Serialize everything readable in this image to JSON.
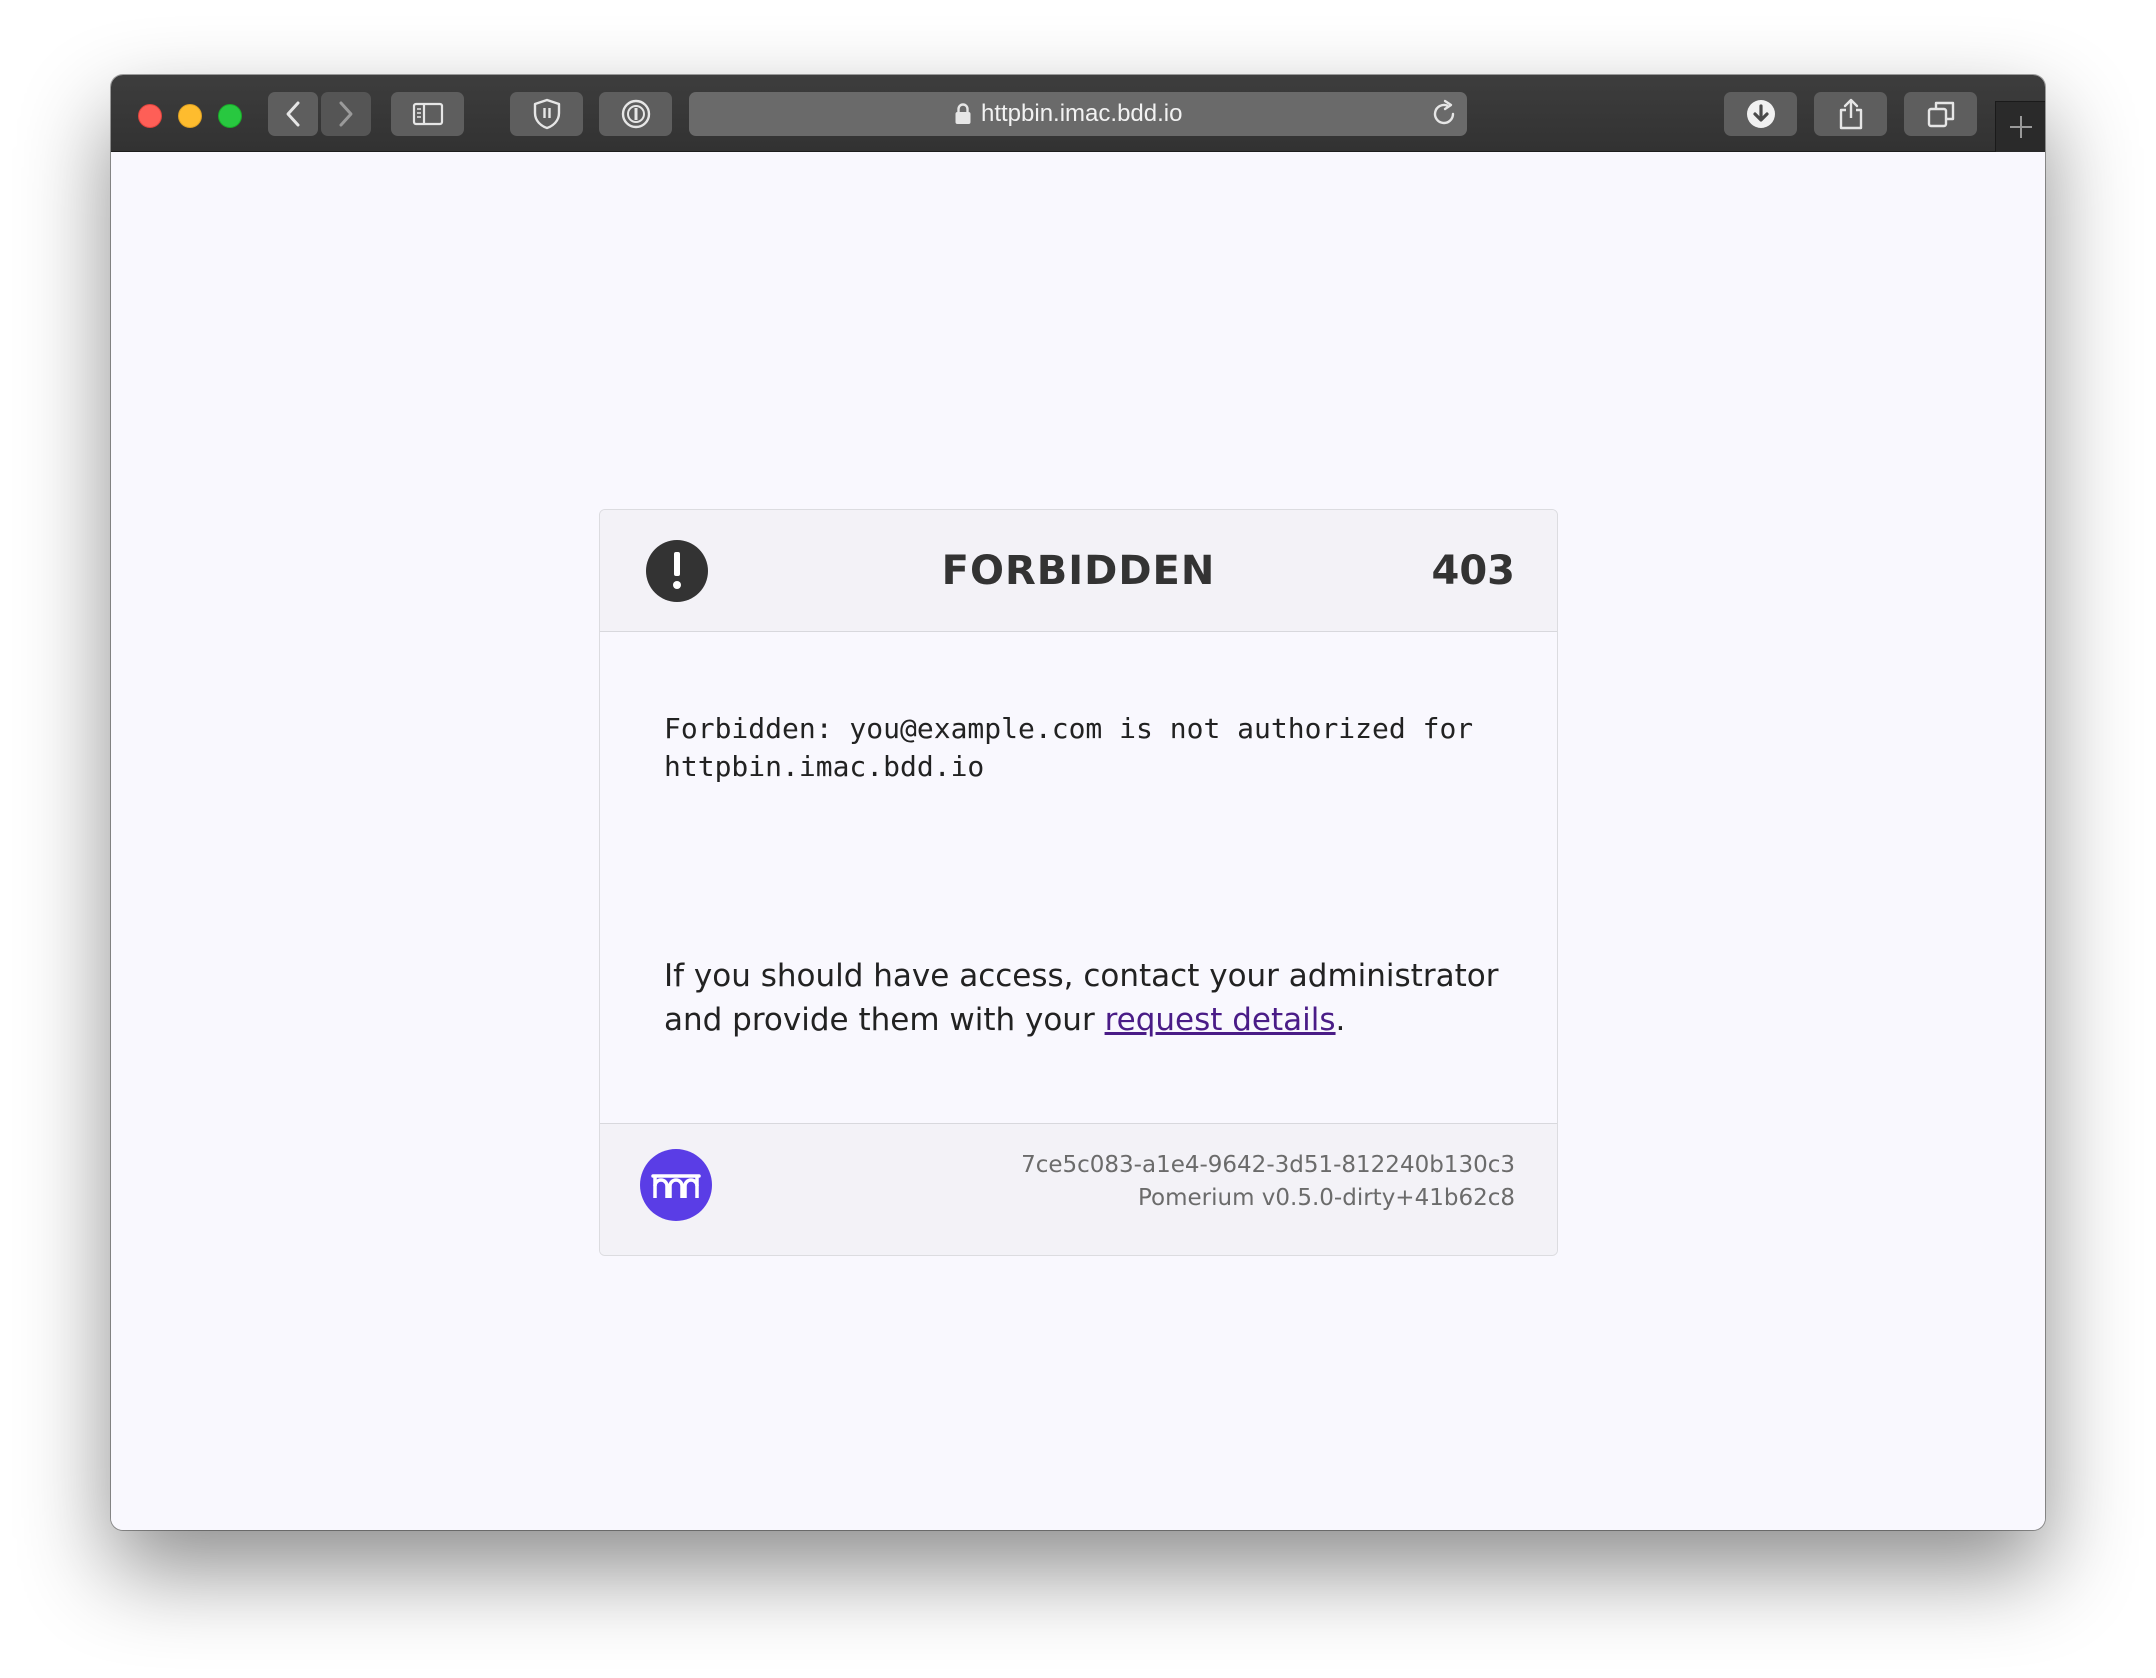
{
  "browser": {
    "url": "httpbin.imac.bdd.io"
  },
  "card": {
    "title": "FORBIDDEN",
    "status_code": "403",
    "message_line1": "Forbidden: you@example.com is not authorized for",
    "message_line2": "httpbin.imac.bdd.io",
    "help_before": "If you should have access, contact your administrator and provide them with your ",
    "help_link": "request details",
    "help_after": "."
  },
  "footer": {
    "request_id": "7ce5c083-a1e4-9642-3d51-812240b130c3",
    "version": "Pomerium v0.5.0-dirty+41b62c8"
  },
  "colors": {
    "brand": "#5a3de6",
    "link": "#4a1c87"
  }
}
